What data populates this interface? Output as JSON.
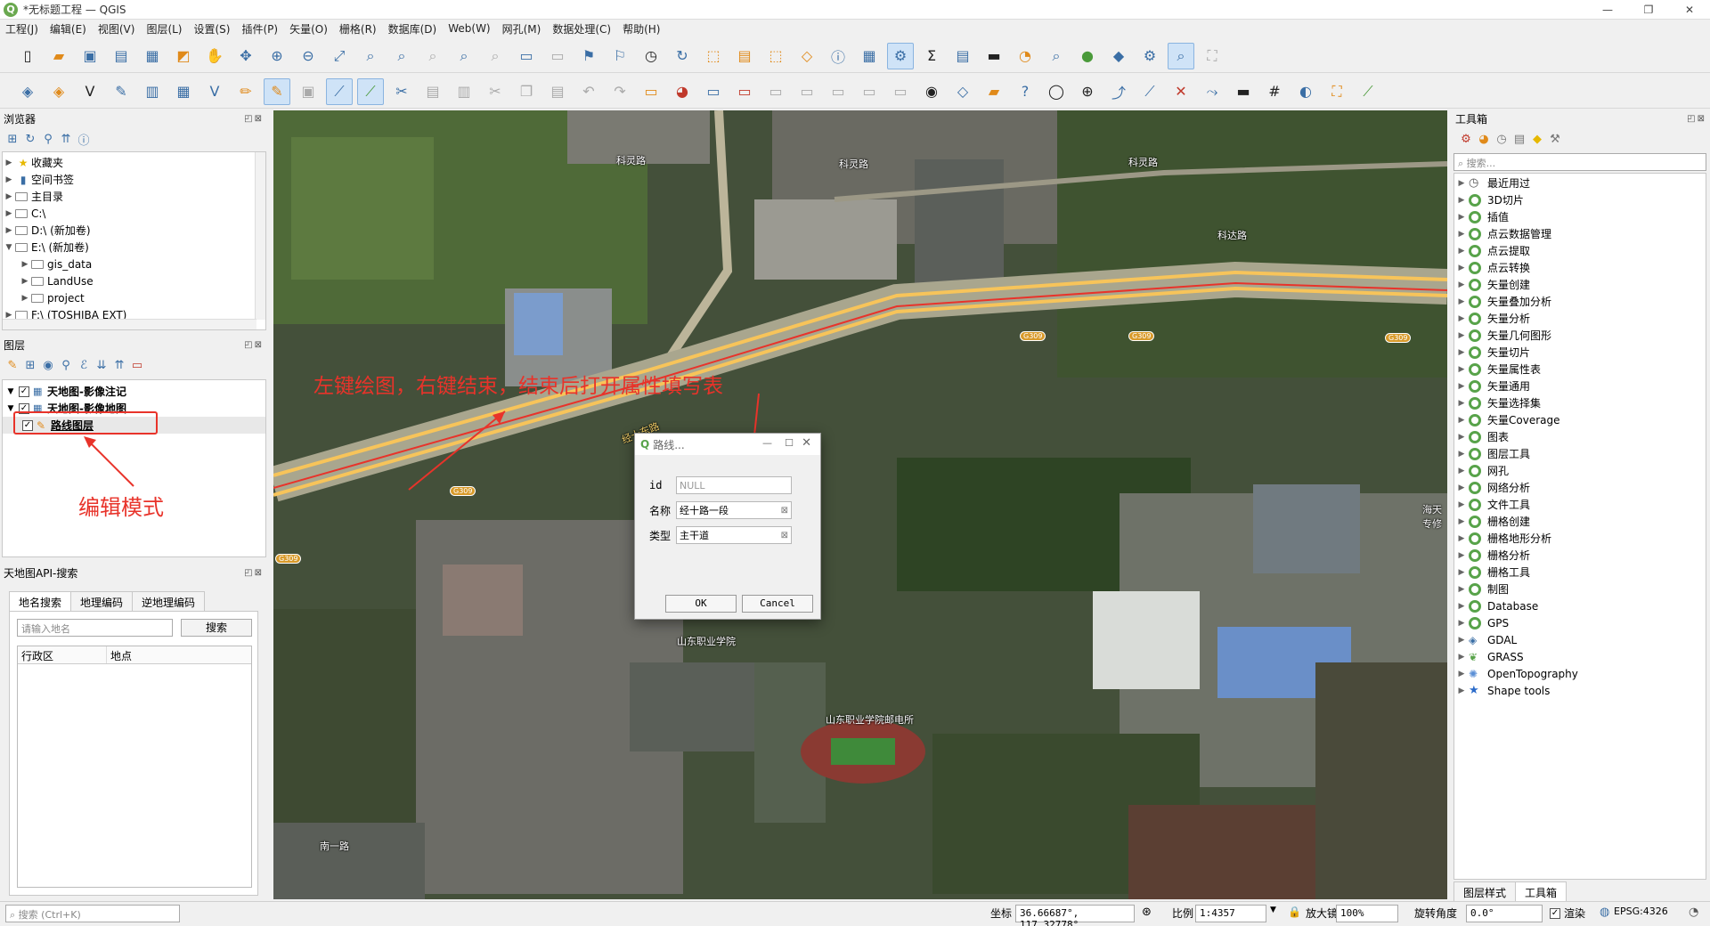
{
  "window": {
    "title": "*无标题工程 — QGIS",
    "controls": [
      "—",
      "❐",
      "✕"
    ]
  },
  "menu": [
    "工程(J)",
    "编辑(E)",
    "视图(V)",
    "图层(L)",
    "设置(S)",
    "插件(P)",
    "矢量(O)",
    "栅格(R)",
    "数据库(D)",
    "Web(W)",
    "网孔(M)",
    "数据处理(C)",
    "帮助(H)"
  ],
  "browser": {
    "title": "浏览器",
    "items": [
      {
        "label": "收藏夹",
        "icon": "star-icon"
      },
      {
        "label": "空间书签",
        "icon": "bookmark-icon"
      },
      {
        "label": "主目录",
        "icon": "folder-icon"
      },
      {
        "label": "C:\\",
        "icon": "folder-icon"
      },
      {
        "label": "D:\\ (新加卷)",
        "icon": "folder-icon"
      },
      {
        "label": "E:\\ (新加卷)",
        "icon": "folder-icon"
      },
      {
        "label": "gis_data",
        "icon": "folder-icon"
      },
      {
        "label": "LandUse",
        "icon": "folder-icon"
      },
      {
        "label": "project",
        "icon": "folder-icon"
      },
      {
        "label": "F:\\ (TOSHIBA EXT)",
        "icon": "folder-icon"
      }
    ]
  },
  "layers": {
    "title": "图层",
    "items": [
      {
        "label": "天地图-影像注记",
        "checked": true
      },
      {
        "label": "天地图-影像地图",
        "checked": true
      },
      {
        "label": "路线图层",
        "checked": true
      }
    ]
  },
  "tianditu": {
    "title": "天地图API-搜索",
    "tabs": [
      "地名搜索",
      "地理编码",
      "逆地理编码"
    ],
    "input_placeholder": "请输入地名",
    "search_button": "搜索",
    "columns": [
      "行政区",
      "地点"
    ]
  },
  "map": {
    "labels": [
      "科灵路",
      "科灵路",
      "科灵路",
      "科达路",
      "经十东路",
      "山东职业学院",
      "山东职业学院邮电所",
      "南一路",
      "海天专修"
    ],
    "shields": [
      "G309",
      "G309",
      "G309",
      "G309",
      "G309"
    ]
  },
  "dialog": {
    "title": "路线...",
    "fields": [
      {
        "label": "id",
        "value": "NULL"
      },
      {
        "label": "名称",
        "value": "经十路一段"
      },
      {
        "label": "类型",
        "value": "主干道"
      }
    ],
    "ok": "OK",
    "cancel": "Cancel"
  },
  "annotations": {
    "map_text": "左键绘图，右键结束，结束后打开属性填写表",
    "edit_mode": "编辑模式",
    "color": "#e8332a"
  },
  "toolbox": {
    "title": "工具箱",
    "search_placeholder": "搜索...",
    "items": [
      "最近用过",
      "3D切片",
      "插值",
      "点云数据管理",
      "点云提取",
      "点云转换",
      "矢量创建",
      "矢量叠加分析",
      "矢量分析",
      "矢量几何图形",
      "矢量切片",
      "矢量属性表",
      "矢量通用",
      "矢量选择集",
      "矢量Coverage",
      "图表",
      "图层工具",
      "网孔",
      "网络分析",
      "文件工具",
      "栅格创建",
      "栅格地形分析",
      "栅格分析",
      "栅格工具",
      "制图",
      "Database",
      "GPS",
      "GDAL",
      "GRASS",
      "OpenTopography",
      "Shape tools"
    ],
    "bottom_tabs": [
      "图层样式",
      "工具箱"
    ]
  },
  "status": {
    "search_placeholder": "搜索 (Ctrl+K)",
    "coord_label": "坐标",
    "coord_value": "36.66687°, 117.32778°",
    "scale_label": "比例",
    "scale_value": "1:4357",
    "magnifier_label": "放大镜",
    "magnifier_value": "100%",
    "rotation_label": "旋转角度",
    "rotation_value": "0.0°",
    "render_label": "渲染",
    "crs": "EPSG:4326"
  }
}
